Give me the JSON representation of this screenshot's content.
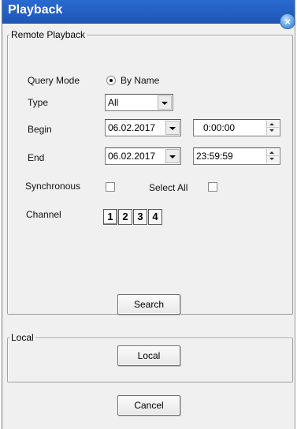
{
  "window": {
    "title": "Playback",
    "close_symbol": "×"
  },
  "remote": {
    "legend": "Remote Playback",
    "query_mode_label": "Query Mode",
    "query_mode_option": "By Name",
    "type_label": "Type",
    "type_value": "All",
    "begin_label": "Begin",
    "begin_date": "06.02.2017",
    "begin_time": "0:00:00",
    "end_label": "End",
    "end_date": "06.02.2017",
    "end_time": "23:59:59",
    "synchronous_label": "Synchronous",
    "select_all_label": "Select All",
    "channel_label": "Channel",
    "channels": [
      "1",
      "2",
      "3",
      "4"
    ],
    "search_label": "Search"
  },
  "local": {
    "legend": "Local",
    "button_label": "Local"
  },
  "footer": {
    "cancel_label": "Cancel"
  }
}
